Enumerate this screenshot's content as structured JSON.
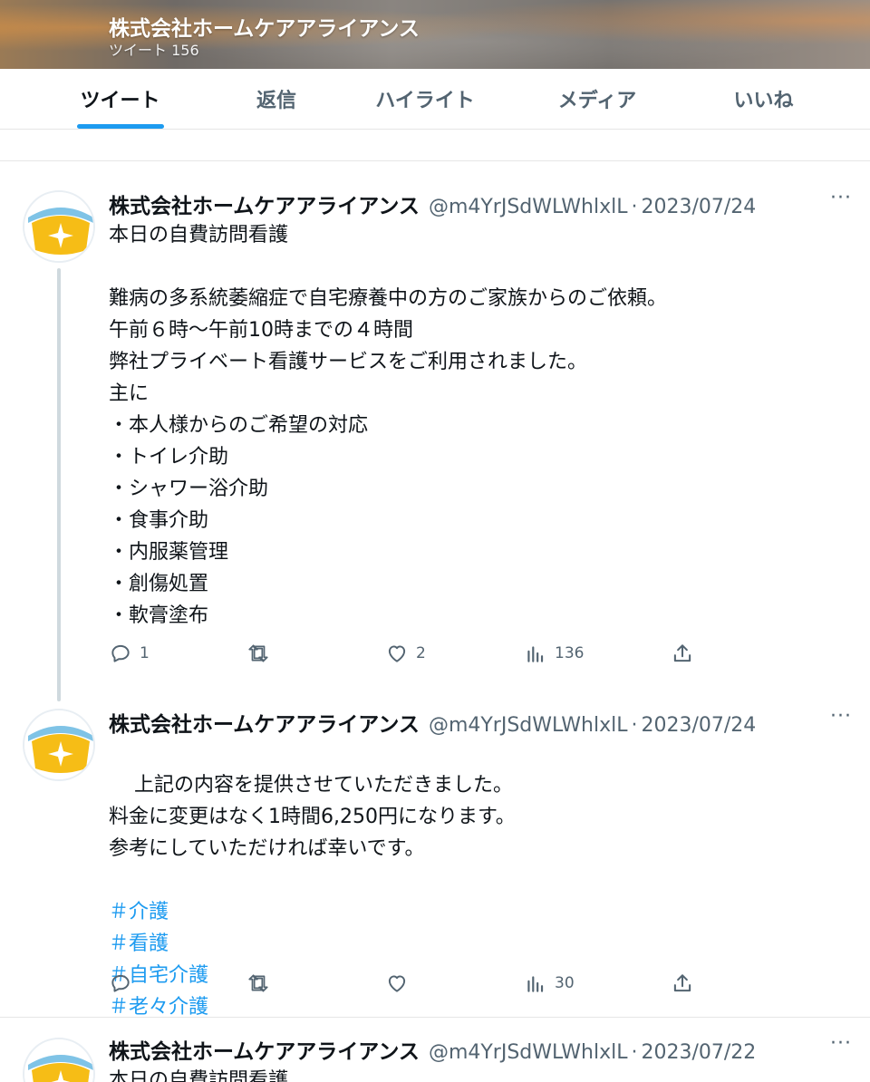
{
  "header": {
    "account_name": "株式会社ホームケアアライアンス",
    "tweet_count": "ツイート 156"
  },
  "tabs": [
    {
      "label": "ツイート",
      "active": true
    },
    {
      "label": "返信",
      "active": false
    },
    {
      "label": "ハイライト",
      "active": false
    },
    {
      "label": "メディア",
      "active": false
    },
    {
      "label": "いいね",
      "active": false
    }
  ],
  "colors": {
    "accent": "#1d9bf0",
    "text": "#0f1419",
    "muted": "#536471",
    "avatar_yellow": "#f6bd16",
    "avatar_sky": "#7fc3e6"
  },
  "tweets": [
    {
      "name": "株式会社ホームケアアライアンス",
      "handle": "@m4YrJSdWLWhlxlL",
      "separator": "·",
      "date": "2023/07/24",
      "more_icon": "more-dots-icon",
      "text": "本日の自費訪問看護\n\n難病の多系統萎縮症で自宅療養中の方のご家族からのご依頼。\n午前６時〜午前10時までの４時間\n弊社プライベート看護サービスをご利用されました。\n主に\n・本人様からのご希望の対応\n・トイレ介助\n・シャワー浴介助\n・食事介助\n・内服薬管理\n・創傷処置\n・軟膏塗布",
      "hashtags": [],
      "replies": "1",
      "retweets": "",
      "likes": "2",
      "views": "136"
    },
    {
      "name": "株式会社ホームケアアライアンス",
      "handle": "@m4YrJSdWLWhlxlL",
      "separator": "·",
      "date": "2023/07/24",
      "more_icon": "more-dots-icon",
      "text": "上記の内容を提供させていただきました。\n料金に変更はなく1時間6,250円になります。\n参考にしていただければ幸いです。",
      "hashtags": [
        "＃介護",
        "＃看護",
        "＃自宅介護",
        "＃老々介護"
      ],
      "replies": "",
      "retweets": "",
      "likes": "",
      "views": "30"
    },
    {
      "name": "株式会社ホームケアアライアンス",
      "handle": "@m4YrJSdWLWhlxlL",
      "separator": "·",
      "date": "2023/07/22",
      "more_icon": "more-dots-icon",
      "text": "本日の自費訪問看護"
    }
  ]
}
